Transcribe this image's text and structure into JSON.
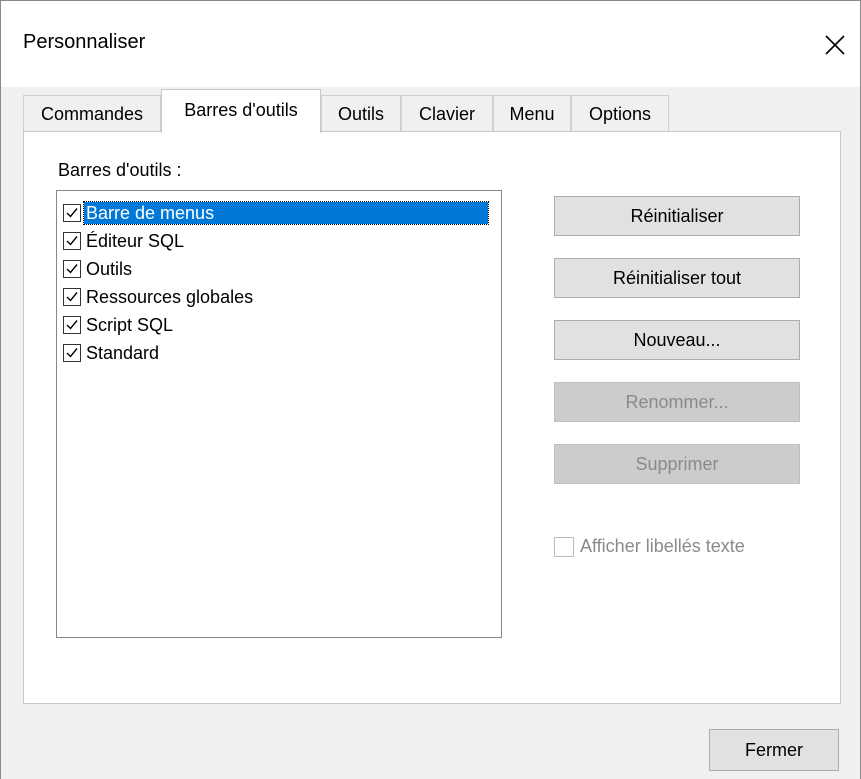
{
  "dialog": {
    "title": "Personnaliser",
    "close_icon": "close-icon"
  },
  "tabs": [
    {
      "label": "Commandes",
      "active": false
    },
    {
      "label": "Barres d'outils",
      "active": true
    },
    {
      "label": "Outils",
      "active": false
    },
    {
      "label": "Clavier",
      "active": false
    },
    {
      "label": "Menu",
      "active": false
    },
    {
      "label": "Options",
      "active": false
    }
  ],
  "toolbars_panel": {
    "list_label": "Barres d'outils :",
    "items": [
      {
        "label": "Barre de menus",
        "checked": true,
        "selected": true
      },
      {
        "label": "Éditeur SQL",
        "checked": true,
        "selected": false
      },
      {
        "label": "Outils",
        "checked": true,
        "selected": false
      },
      {
        "label": "Ressources globales",
        "checked": true,
        "selected": false
      },
      {
        "label": "Script SQL",
        "checked": true,
        "selected": false
      },
      {
        "label": "Standard",
        "checked": true,
        "selected": false
      }
    ],
    "buttons": {
      "reset": "Réinitialiser",
      "reset_all": "Réinitialiser tout",
      "new": "Nouveau...",
      "rename": "Renommer...",
      "delete": "Supprimer"
    },
    "show_text_labels": {
      "label": "Afficher libellés texte",
      "checked": false,
      "enabled": false
    }
  },
  "footer": {
    "close_label": "Fermer"
  },
  "colors": {
    "selection": "#0078d7",
    "dialog_bg": "#f0f0f0",
    "button_bg": "#e1e1e1",
    "disabled_text": "#8a8a8a"
  }
}
